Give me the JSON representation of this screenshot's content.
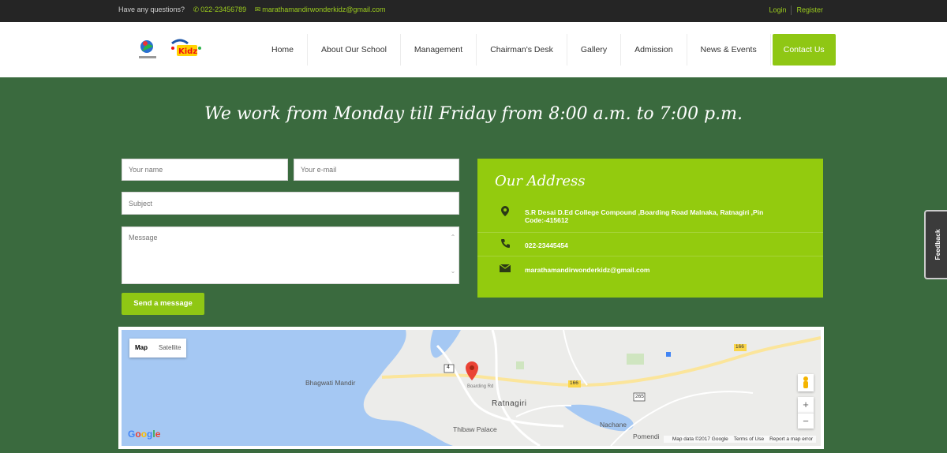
{
  "topbar": {
    "question": "Have any questions?",
    "phone": "022-23456789",
    "email": "marathamandirwonderkidz@gmail.com",
    "login": "Login",
    "register": "Register"
  },
  "logo": {
    "text": "Wonder Kidz",
    "alt": "Wonder Kidz logo"
  },
  "nav": {
    "items": [
      {
        "label": "Home"
      },
      {
        "label": "About Our School"
      },
      {
        "label": "Management"
      },
      {
        "label": "Chairman's Desk"
      },
      {
        "label": "Gallery"
      },
      {
        "label": "Admission"
      },
      {
        "label": "News & Events"
      }
    ],
    "contact": "Contact Us"
  },
  "headline": "We work from Monday till Friday from 8:00 a.m. to 7:00 p.m.",
  "form": {
    "name_placeholder": "Your name",
    "email_placeholder": "Your e-mail",
    "subject_placeholder": "Subject",
    "message_placeholder": "Message",
    "send_label": "Send a message"
  },
  "address": {
    "title": "Our Address",
    "location": "S.R Desai D.Ed College Compound ,Boarding Road Malnaka, Ratnagiri ,Pin Code:-415612",
    "phone": "022-23445454",
    "email": "marathamandirwonderkidz@gmail.com"
  },
  "map": {
    "type_map": "Map",
    "type_satellite": "Satellite",
    "labels": {
      "bhagwati": "Bhagwati Mandir",
      "ratnagiri": "Ratnagiri",
      "thibaw": "Thibaw Palace",
      "nachane": "Nachane",
      "pomendi": "Pomendi",
      "road_4": "4",
      "road_166": "166",
      "road_166b": "166",
      "road_265": "265",
      "boarding": "Boarding Rd"
    },
    "google": "Google",
    "attribution": "Map data ©2017 Google",
    "terms": "Terms of Use",
    "report": "Report a map error",
    "zoom_in": "+",
    "zoom_out": "−"
  },
  "feedback": "Feedback",
  "colors": {
    "accent": "#8fc714",
    "background": "#3a6a3e",
    "topbar": "#252525"
  }
}
